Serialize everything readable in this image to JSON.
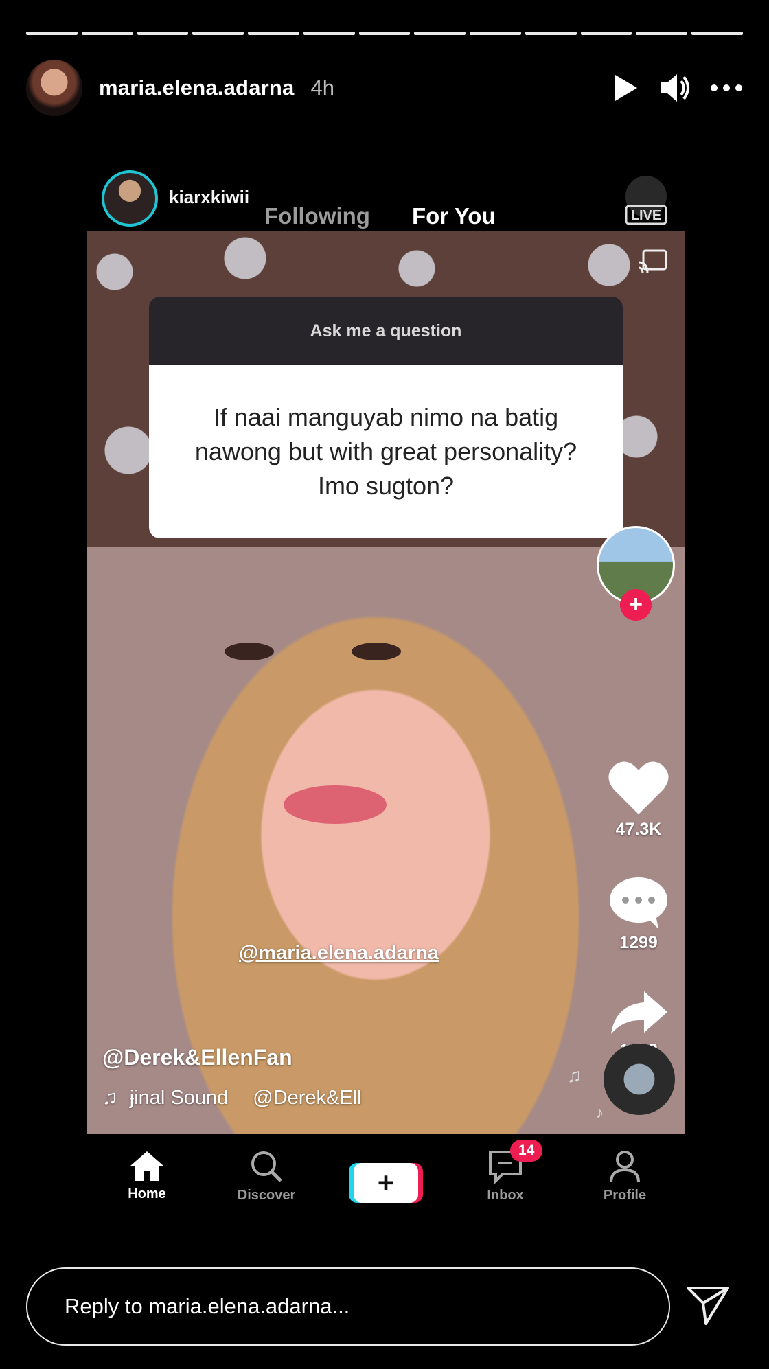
{
  "story": {
    "username": "maria.elena.adarna",
    "time_ago": "4h",
    "progress_segments": 13,
    "icons": [
      "play-icon",
      "volume-icon",
      "more-icon"
    ]
  },
  "tiktok": {
    "username": "kiarxkiwii",
    "feed_tabs": [
      "Following",
      "For You"
    ],
    "live_label": "LIVE",
    "question_card": {
      "header": "Ask me a question",
      "question": "If naai manguyab nimo na batig nawong but with great personality? Imo sugton?"
    },
    "mention": "@maria.elena.adarna",
    "creator": "@Derek&EllenFan",
    "sound": {
      "title": "ɉinal Sound",
      "author": "@Derek&Ell"
    },
    "likes": "47.3K",
    "comments": "1299",
    "shares": "1848",
    "nav": [
      {
        "label": "Home",
        "icon": "home-icon"
      },
      {
        "label": "Discover",
        "icon": "search-icon"
      },
      {
        "label": "+",
        "icon": "create-icon"
      },
      {
        "label": "Inbox",
        "icon": "inbox-icon",
        "badge": "14"
      },
      {
        "label": "Profile",
        "icon": "profile-icon"
      }
    ]
  },
  "reply": {
    "placeholder": "Reply to maria.elena.adarna..."
  },
  "colors": {
    "background": "#000000",
    "tiktok_red": "#ee1d52",
    "tiktok_cyan": "#20d5ec"
  }
}
